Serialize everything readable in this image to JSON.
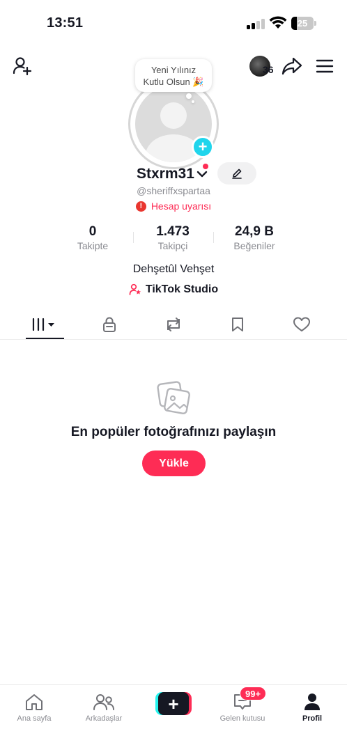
{
  "status_bar": {
    "time": "13:51",
    "battery": "25",
    "battery_level": 0.25
  },
  "header": {
    "story_count": "36",
    "bubble_text_line1": "Yeni Yılınız",
    "bubble_text_line2": "Kutlu Olsun 🎉"
  },
  "profile": {
    "display_name": "Stxrm31",
    "handle": "@sheriffxspartaa",
    "warning": "Hesap uyarısı",
    "bio": "Dehşetûl Vehşet",
    "studio_link": "TikTok Studio"
  },
  "stats": [
    {
      "value": "0",
      "label": "Takipte"
    },
    {
      "value": "1.473",
      "label": "Takipçi"
    },
    {
      "value": "24,9 B",
      "label": "Beğeniler"
    }
  ],
  "tabs": [
    {
      "name": "videos-grid-icon",
      "active": true
    },
    {
      "name": "lock-icon",
      "active": false
    },
    {
      "name": "repost-icon",
      "active": false
    },
    {
      "name": "bookmark-icon",
      "active": false
    },
    {
      "name": "heart-icon",
      "active": false
    }
  ],
  "empty_state": {
    "title": "En popüler fotoğrafınızı paylaşın",
    "button": "Yükle"
  },
  "bottom_nav": {
    "home": "Ana sayfa",
    "friends": "Arkadaşlar",
    "inbox": "Gelen kutusu",
    "inbox_badge": "99+",
    "profile": "Profil"
  },
  "colors": {
    "accent": "#fe2c55",
    "cyan": "#20d5ec",
    "text": "#161823",
    "muted": "#8a8b91"
  }
}
